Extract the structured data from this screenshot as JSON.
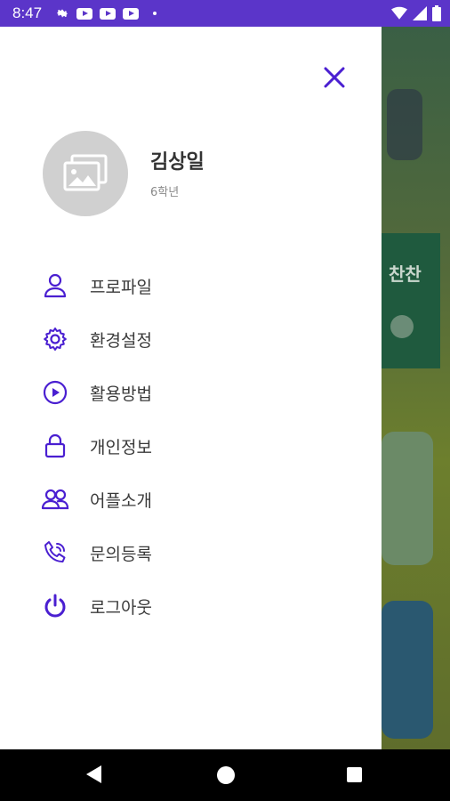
{
  "status_bar": {
    "time": "8:47",
    "icons_left": [
      "gear-icon",
      "youtube-icon",
      "youtube-icon",
      "youtube-icon",
      "dot-icon"
    ],
    "icons_right": [
      "wifi-icon",
      "signal-icon",
      "battery-icon"
    ]
  },
  "drawer": {
    "close_icon": "close-icon",
    "user": {
      "name": "김상일",
      "grade": "6학년",
      "avatar_icon": "image-placeholder-icon"
    },
    "menu": [
      {
        "label": "프로파일",
        "icon": "person-icon"
      },
      {
        "label": "환경설정",
        "icon": "gear-icon"
      },
      {
        "label": "활용방법",
        "icon": "play-circle-icon"
      },
      {
        "label": "개인정보",
        "icon": "lock-icon"
      },
      {
        "label": "어플소개",
        "icon": "users-icon"
      },
      {
        "label": "문의등록",
        "icon": "phone-icon"
      },
      {
        "label": "로그아웃",
        "icon": "power-icon"
      }
    ]
  },
  "background": {
    "card_title": "찬찬"
  },
  "nav_bar": {
    "buttons": [
      "back-icon",
      "home-icon",
      "recent-apps-icon"
    ]
  },
  "colors": {
    "status_bar": "#5b35c9",
    "accent": "#4a1fd1",
    "text": "#3a3a3a",
    "subtext": "#8a8a8a"
  }
}
